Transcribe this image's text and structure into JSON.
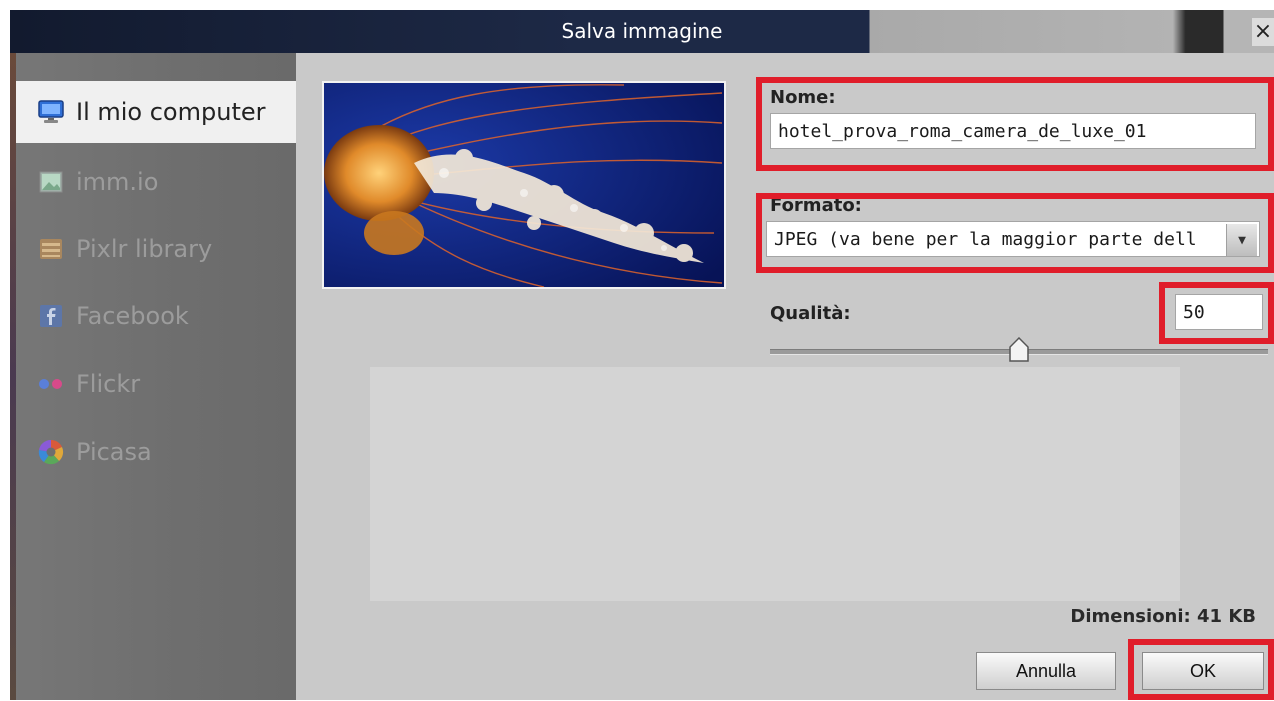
{
  "dialog": {
    "title": "Salva immagine",
    "close_label": "×"
  },
  "sidebar": {
    "items": [
      {
        "label": "Il mio computer",
        "icon": "monitor-icon",
        "active": true
      },
      {
        "label": "imm.io",
        "icon": "image-icon",
        "active": false
      },
      {
        "label": "Pixlr library",
        "icon": "library-icon",
        "active": false
      },
      {
        "label": "Facebook",
        "icon": "facebook-icon",
        "active": false
      },
      {
        "label": "Flickr",
        "icon": "flickr-icon",
        "active": false
      },
      {
        "label": "Picasa",
        "icon": "picasa-icon",
        "active": false
      }
    ]
  },
  "form": {
    "name_label": "Nome:",
    "name_value": "hotel_prova_roma_camera_de_luxe_01",
    "format_label": "Formato:",
    "format_value": "JPEG (va bene per la maggior parte dell",
    "quality_label": "Qualità:",
    "quality_value": "50",
    "quality_fraction": 0.5
  },
  "footer": {
    "size_label": "Dimensioni: 41 KB",
    "cancel_label": "Annulla",
    "ok_label": "OK"
  },
  "colors": {
    "highlight": "#e01d2a",
    "titlebar": "#1d2946"
  }
}
